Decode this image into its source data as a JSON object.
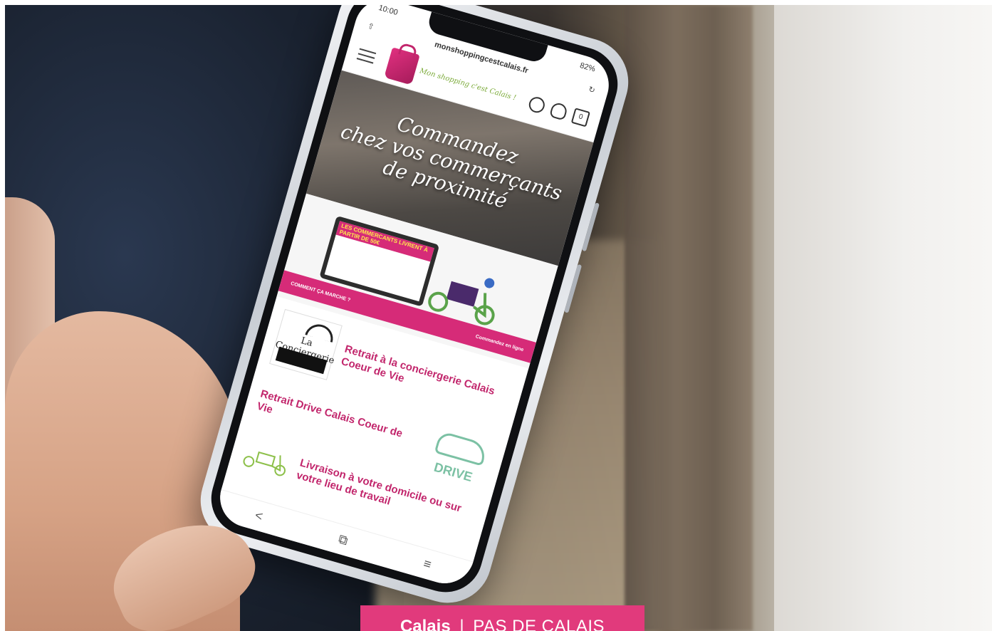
{
  "phone": {
    "status": {
      "time": "10:00",
      "battery": "82%"
    },
    "url": "monshoppingcestcalais.fr",
    "logo_text": "Mon shopping c'est Calais !",
    "cart_count": "0",
    "hero_text": "Commandez\nchez vos commerçants\nde proximité",
    "promo": {
      "laptop_banner": "LES COMMERCANTS LIVRENT À PARTIR DE 50€",
      "bar_left": "COMMENT ÇA MARCHE ?",
      "bar_right": "Commandez en ligne"
    },
    "services": [
      {
        "label": "Retrait à la conciergerie Calais Coeur de Vie"
      },
      {
        "label": "Retrait Drive Calais Coeur de Vie"
      },
      {
        "label": "Livraison à votre domicile ou sur votre lieu de travail"
      }
    ],
    "concierge_title": "La Conciergerie",
    "drive_word": "DRIVE",
    "nav": {
      "back": "<",
      "tabs": "⧉",
      "menu": "≡"
    }
  },
  "caption": {
    "city": "Calais",
    "separator": "|",
    "region": "PAS DE CALAIS"
  },
  "colors": {
    "brand_pink": "#e13a7c",
    "site_pink": "#c2266c",
    "drive_green": "#7cc1a4",
    "logo_green": "#7cab3a"
  },
  "icons": [
    "menu-icon",
    "search-icon",
    "user-icon",
    "cart-icon",
    "share-icon",
    "refresh-icon",
    "cargo-bike-icon",
    "car-icon",
    "cloche-icon"
  ]
}
